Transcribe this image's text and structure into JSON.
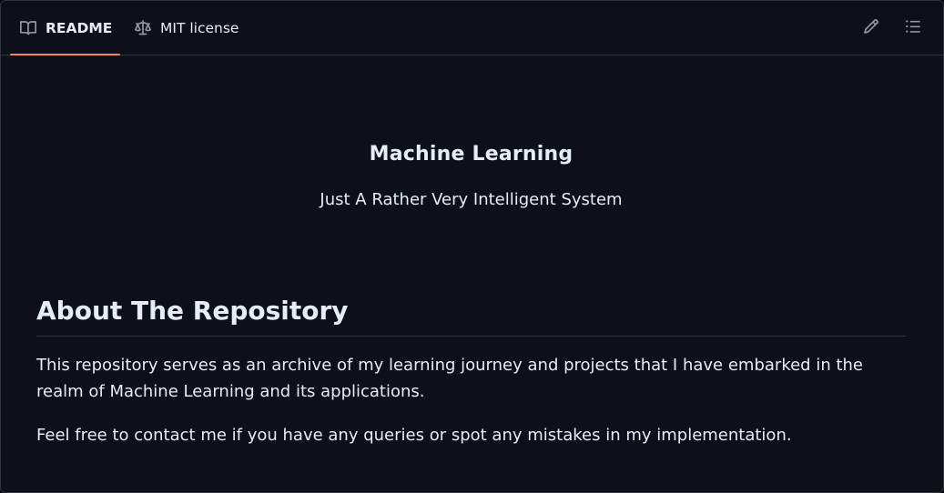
{
  "tabs": {
    "readme": {
      "label": "README",
      "icon": "book-icon",
      "active": true
    },
    "license": {
      "label": "MIT license",
      "icon": "law-icon"
    }
  },
  "actions": {
    "edit_icon": "pencil-icon",
    "outline_icon": "list-unordered-icon"
  },
  "readme": {
    "title": "Machine Learning",
    "subtitle": "Just A Rather Very Intelligent System",
    "section_heading": "About The Repository",
    "paragraphs": [
      "This repository serves as an archive of my learning journey and projects that I have embarked in the realm of Machine Learning and its applications.",
      "Feel free to contact me if you have any queries or spot any mistakes in my implementation."
    ]
  },
  "colors": {
    "accent_underline": "#f78166",
    "background": "#0d1117",
    "border": "#30363d",
    "text": "#e6edf3",
    "muted_icon": "#9198a1"
  }
}
